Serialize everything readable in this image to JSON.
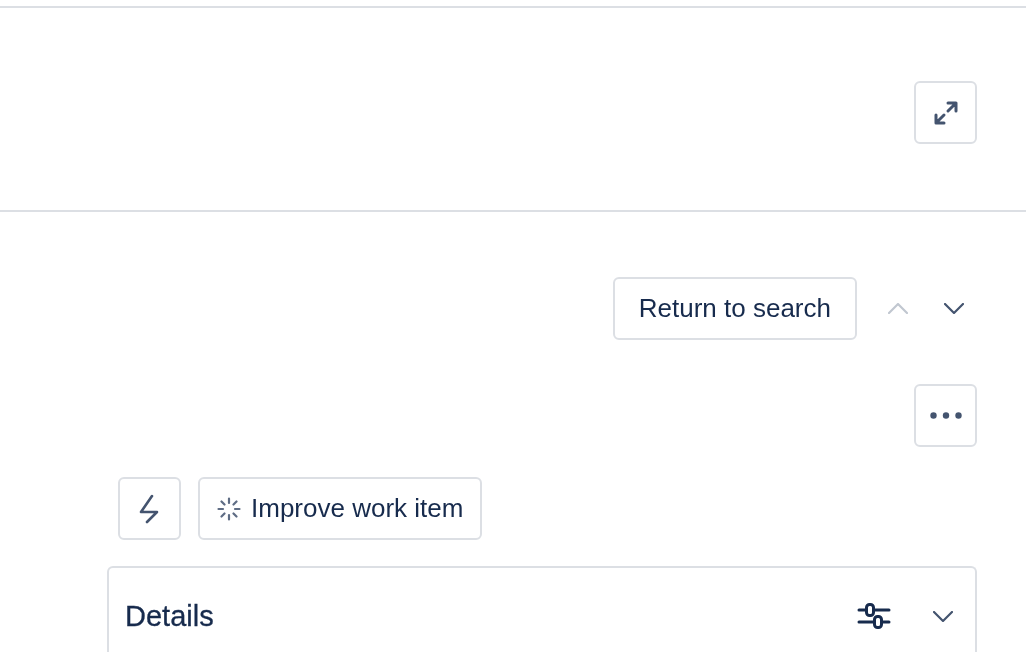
{
  "navigation": {
    "return_button": "Return to search",
    "pager": [
      {
        "kind": "previous",
        "disabled": true
      },
      {
        "kind": "next",
        "disabled": false
      }
    ]
  },
  "actions": {
    "improve_button": "Improve work item"
  },
  "details_panel": {
    "title": "Details"
  }
}
